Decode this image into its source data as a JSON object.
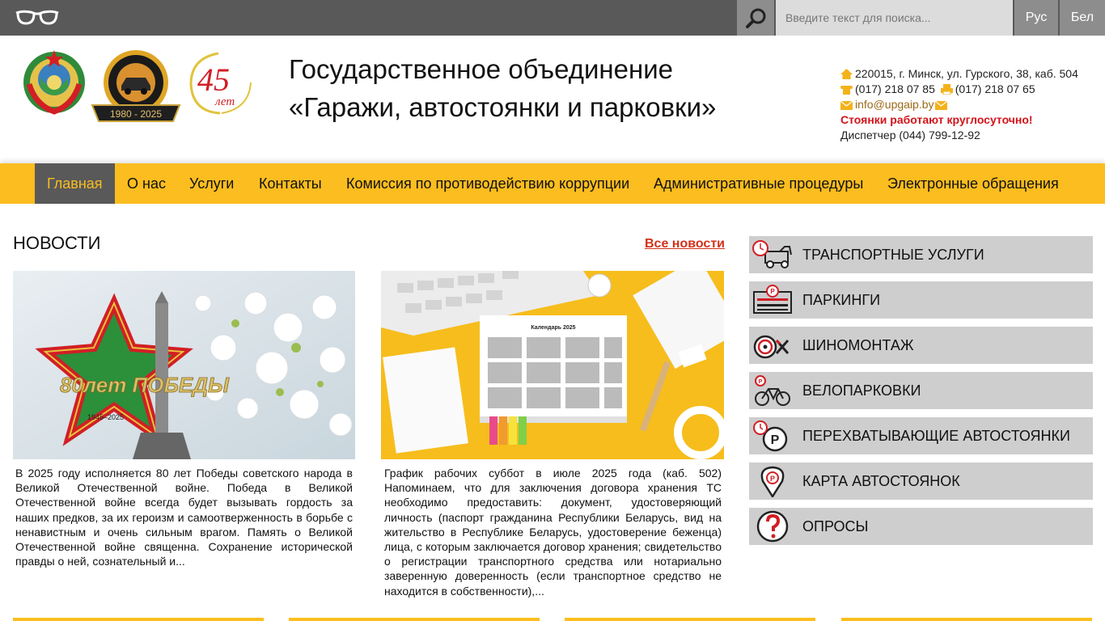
{
  "topbar": {
    "accessibility_icon": "glasses-icon",
    "search_icon": "magnifier-icon",
    "search_placeholder": "Введите текст для поиска...",
    "lang_ru": "Рус",
    "lang_be": "Бел"
  },
  "header": {
    "logo_45_number": "45",
    "logo_45_word": "лет",
    "title_line1": "Государственное объединение",
    "title_line2": "«Гаражи, автостоянки и парковки»",
    "address": "220015, г. Минск, ул. Гурского, 38, каб. 504",
    "phone": "(017) 218 07 85",
    "fax": "(017) 218 07 65",
    "email": "info@upgaip.by",
    "notice": "Стоянки работают круглосуточно!",
    "dispatcher": "Диспетчер (044) 799-12-92"
  },
  "nav": {
    "items": [
      {
        "label": "Главная"
      },
      {
        "label": "О нас"
      },
      {
        "label": "Услуги"
      },
      {
        "label": "Контакты"
      },
      {
        "label": "Комиссия по противодействию коррупции"
      },
      {
        "label": "Административные процедуры"
      },
      {
        "label": "Электронные обращения"
      }
    ]
  },
  "news": {
    "heading": "НОВОСТИ",
    "all_news": "Все новости",
    "items": [
      {
        "image_caption_big": "80лет ПОБЕДЫ",
        "image_caption_years": "1945–2025",
        "text": "В 2025 году исполняется 80 лет Победы советского народа в Великой Отечественной войне.      Победа в Великой Отечественной войне всегда будет вызывать гордость за наших предков, за их героизм и самоотверженность в борьбе с ненавистным и очень сильным врагом.  Память о Великой Отечественной войне священна. Сохранение исторической правды о ней, сознательный и..."
      },
      {
        "image_caption": "Календарь 2025",
        "text": "График рабочих суббот в июле 2025 года (каб. 502) Напоминаем, что для заключения договора хранения ТС необходимо предоставить: документ, удостоверяющий личность (паспорт гражданина Республики Беларусь, вид на жительство в Республике Беларусь, удостоверение беженца) лица, с которым заключается договор хранения; свидетельство о регистрации транспортного средства или нотариально заверенную доверенность (если транспортное средство не находится в собственности),..."
      }
    ]
  },
  "sidebar": {
    "items": [
      {
        "label": "ТРАНСПОРТНЫЕ УСЛУГИ",
        "icon": "tow-truck-icon"
      },
      {
        "label": "ПАРКИНГИ",
        "icon": "parking-gate-icon"
      },
      {
        "label": "ШИНОМОНТАЖ",
        "icon": "tire-service-icon"
      },
      {
        "label": "ВЕЛОПАРКОВКИ",
        "icon": "bicycle-parking-icon"
      },
      {
        "label": "ПЕРЕХВАТЫВАЮЩИЕ АВТОСТОЯНКИ",
        "icon": "park-and-ride-icon"
      },
      {
        "label": "КАРТА АВТОСТОЯНОК",
        "icon": "map-pin-icon"
      },
      {
        "label": "ОПРОСЫ",
        "icon": "question-icon"
      }
    ]
  },
  "colors": {
    "accent_yellow": "#fbbd1f",
    "dark_gray": "#595959",
    "link_red": "#d2321a"
  }
}
